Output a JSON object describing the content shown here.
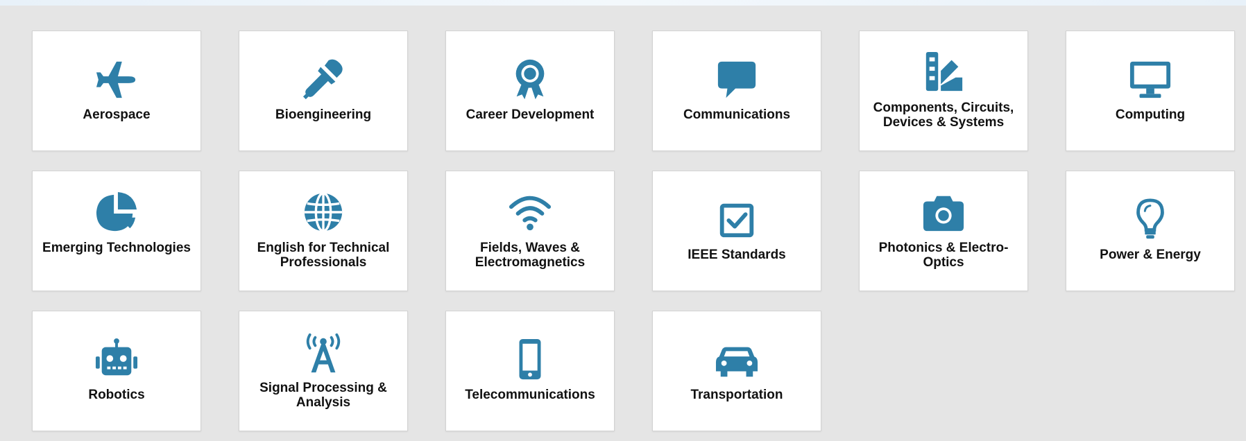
{
  "theme": {
    "icon_color": "#2e7fa8",
    "tile_background": "#ffffff",
    "panel_background": "#e5e5e5"
  },
  "tiles": [
    {
      "label": "Aerospace",
      "icon": "airplane-icon"
    },
    {
      "label": "Bioengineering",
      "icon": "eyedropper-icon"
    },
    {
      "label": "Career Development",
      "icon": "award-ribbon-icon"
    },
    {
      "label": "Communications",
      "icon": "speech-bubble-icon"
    },
    {
      "label": "Components, Circuits, Devices & Systems",
      "icon": "swatchbook-icon"
    },
    {
      "label": "Computing",
      "icon": "desktop-monitor-icon"
    },
    {
      "label": "Emerging Technologies",
      "icon": "pie-chart-icon"
    },
    {
      "label": "English for Technical Professionals",
      "icon": "globe-icon"
    },
    {
      "label": "Fields, Waves & Electromagnetics",
      "icon": "wifi-icon"
    },
    {
      "label": "IEEE Standards",
      "icon": "checkbox-icon"
    },
    {
      "label": "Photonics & Electro-Optics",
      "icon": "camera-icon"
    },
    {
      "label": "Power & Energy",
      "icon": "lightbulb-icon"
    },
    {
      "label": "Robotics",
      "icon": "robot-icon"
    },
    {
      "label": "Signal Processing & Analysis",
      "icon": "broadcast-tower-icon"
    },
    {
      "label": "Telecommunications",
      "icon": "mobile-phone-icon"
    },
    {
      "label": "Transportation",
      "icon": "car-icon"
    }
  ]
}
